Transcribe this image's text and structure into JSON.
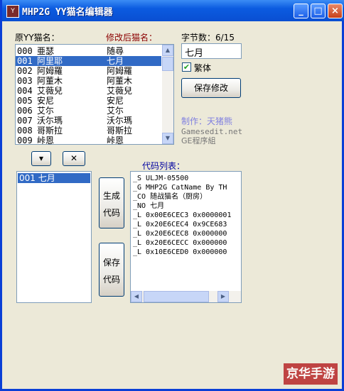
{
  "window": {
    "title": "MHP2G  YY猫名编辑器",
    "icon": "app-icon"
  },
  "titlebar_buttons": {
    "minimize": "_",
    "maximize": "□",
    "close": "×"
  },
  "labels": {
    "original": "原YY猫名：",
    "modified": "修改后猫名：",
    "byte_count": "字节数：6/15",
    "code_list": "代码列表："
  },
  "name_list": [
    {
      "id": "000",
      "orig": "亜瑟",
      "mod": "随尋"
    },
    {
      "id": "001",
      "orig": "阿里耶",
      "mod": "七月"
    },
    {
      "id": "002",
      "orig": "阿姆羅",
      "mod": "阿姆羅"
    },
    {
      "id": "003",
      "orig": "阿董木",
      "mod": "阿董木"
    },
    {
      "id": "004",
      "orig": "艾薇兒",
      "mod": "艾薇兒"
    },
    {
      "id": "005",
      "orig": "安尼",
      "mod": "安尼"
    },
    {
      "id": "006",
      "orig": "艾尓",
      "mod": "艾尓"
    },
    {
      "id": "007",
      "orig": "沃尓瑪",
      "mod": "沃尓瑪"
    },
    {
      "id": "008",
      "orig": "哥斯拉",
      "mod": "哥斯拉"
    },
    {
      "id": "009",
      "orig": "峠恩",
      "mod": "峠恩"
    }
  ],
  "name_input": {
    "value": "七月"
  },
  "traditional_checkbox": {
    "label": "繁体",
    "checked": "✔"
  },
  "save_change_button": "保存修改",
  "credits": {
    "maker": "制作：天猪熊",
    "site": "Gamesedit.net",
    "group": "GE程序組"
  },
  "small_buttons": {
    "dropdown": "▾",
    "delete": "✕"
  },
  "selected_list": [
    "001 七月"
  ],
  "generate_button": {
    "line1": "生成",
    "line2": "代码"
  },
  "save_code_button": {
    "line1": "保存",
    "line2": "代码"
  },
  "code_lines": [
    "_S ULJM-05500",
    "_G MHP2G CatName By TH",
    "_CO 随战猫名（厨房）",
    "_NO 七月",
    "_L 0x00E6CEC3 0x0000001",
    "_L 0x20E6CEC4 0x9CE683",
    "_L 0x20E6CEC8 0x000000",
    "_L 0x20E6CECC 0x000000",
    "_L 0x10E6CED0 0x000000"
  ],
  "watermark": "京华手游",
  "colors": {
    "titlebar": "#0a4fd2",
    "selection": "#316ac5",
    "window_bg": "#ece9d8",
    "credit_purple": "#8080e0"
  }
}
